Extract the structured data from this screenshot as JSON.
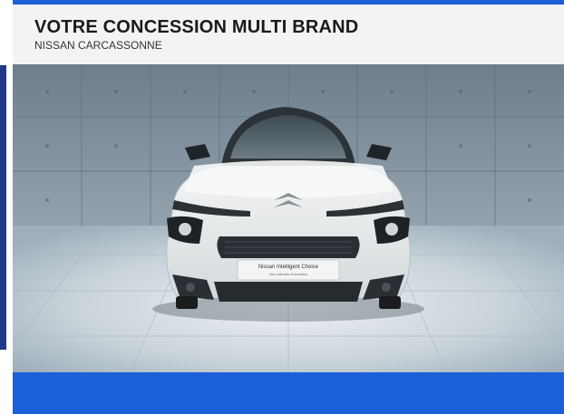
{
  "header": {
    "title": "VOTRE CONCESSION MULTI BRAND",
    "subtitle": "NISSAN CARCASSONNE"
  },
  "photo": {
    "plate_line1": "Nissan Intelligent Choice",
    "plate_line2": "Nos voitures d'occasion"
  },
  "colors": {
    "brand_blue": "#1b5fd9",
    "header_bg": "#f3f3f3"
  }
}
